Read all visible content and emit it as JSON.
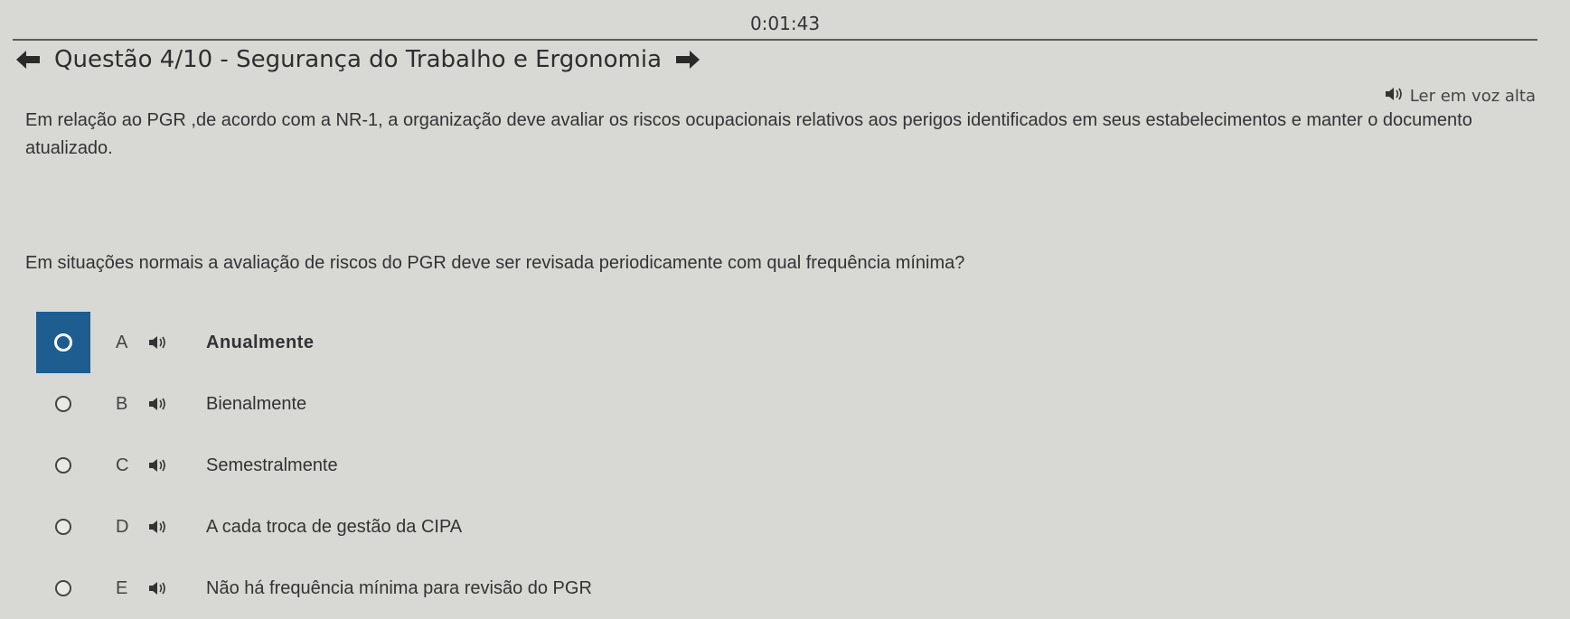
{
  "timer": "0:01:43",
  "header": {
    "title": "Questão 4/10 - Segurança do Trabalho e Ergonomia",
    "prev_icon": "arrow-left-icon",
    "next_icon": "arrow-right-icon"
  },
  "read_aloud": {
    "label": "Ler em voz alta",
    "icon": "speaker-icon"
  },
  "statement": "Em relação ao PGR ,de acordo com a NR-1, a organização deve avaliar os riscos ocupacionais relativos aos perigos identificados em seus estabelecimentos e manter o documento atualizado.",
  "question": "Em situações normais a avaliação de riscos do PGR deve ser revisada periodicamente com qual frequência mínima?",
  "options": [
    {
      "letter": "A",
      "text": "Anualmente",
      "selected": true
    },
    {
      "letter": "B",
      "text": "Bienalmente",
      "selected": false
    },
    {
      "letter": "C",
      "text": "Semestralmente",
      "selected": false
    },
    {
      "letter": "D",
      "text": "A cada troca de gestão da CIPA",
      "selected": false
    },
    {
      "letter": "E",
      "text": "Não há frequência mínima para revisão do PGR",
      "selected": false
    }
  ],
  "colors": {
    "selected_accent": "#1d5d8f",
    "background": "#d8d8d4"
  }
}
